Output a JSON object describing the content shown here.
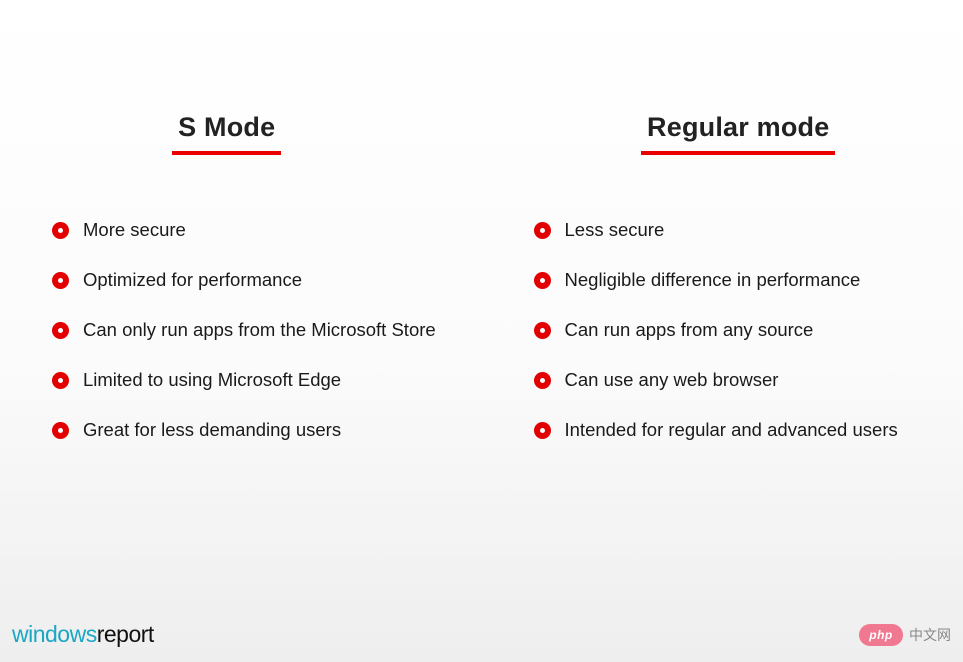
{
  "columns": {
    "left": {
      "heading": "S Mode",
      "items": [
        "More secure",
        "Optimized for performance",
        "Can only run apps from the Microsoft Store",
        "Limited to using Microsoft Edge",
        "Great for less demanding users"
      ]
    },
    "right": {
      "heading": "Regular mode",
      "items": [
        "Less secure",
        "Negligible difference in performance",
        "Can run apps from any source",
        "Can use any web browser",
        "Intended for regular and advanced users"
      ]
    }
  },
  "footer": {
    "brand_part1": "windows",
    "brand_part2": "report",
    "badge": "php",
    "site": "中文网"
  },
  "colors": {
    "accent_red": "#e30000",
    "brand_teal": "#1aa7c4",
    "badge_pink": "#f07890"
  }
}
